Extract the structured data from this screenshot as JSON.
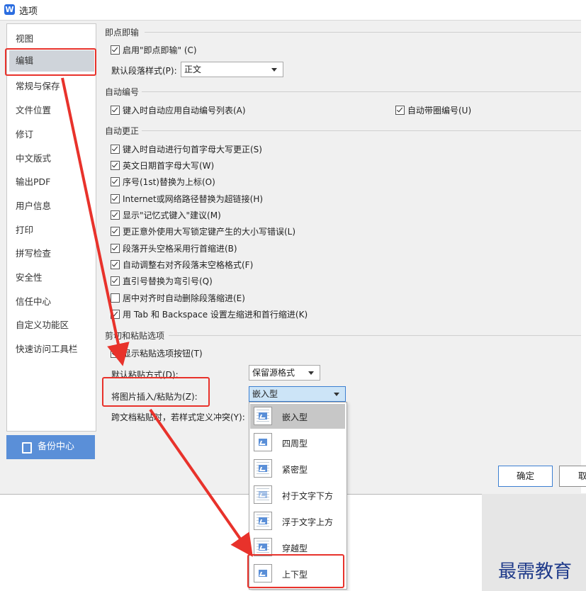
{
  "window": {
    "title": "选项",
    "icon": "app-w-icon"
  },
  "sidebar": {
    "items": [
      {
        "label": "视图"
      },
      {
        "label": "编辑",
        "selected": true
      },
      {
        "label": "常规与保存"
      },
      {
        "label": "文件位置"
      },
      {
        "label": "修订"
      },
      {
        "label": "中文版式"
      },
      {
        "label": "输出PDF"
      },
      {
        "label": "用户信息"
      },
      {
        "label": "打印"
      },
      {
        "label": "拼写检查"
      },
      {
        "label": "安全性"
      },
      {
        "label": "信任中心"
      },
      {
        "label": "自定义功能区"
      },
      {
        "label": "快速访问工具栏"
      }
    ],
    "backup_button": "备份中心"
  },
  "sections": {
    "click_and_type": {
      "title": "即点即输",
      "enable_label": "启用\"即点即输\" (C)",
      "enable_checked": true,
      "default_style_label": "默认段落样式(P):",
      "default_style_value": "正文"
    },
    "auto_numbering": {
      "title": "自动编号",
      "list_label": "键入时自动应用自动编号列表(A)",
      "list_checked": true,
      "circled_label": "自动带圈编号(U)",
      "circled_checked": true
    },
    "autocorrect": {
      "title": "自动更正",
      "items": [
        {
          "label": "键入时自动进行句首字母大写更正(S)",
          "checked": true
        },
        {
          "label": "英文日期首字母大写(W)",
          "checked": true
        },
        {
          "label": "序号(1st)替换为上标(O)",
          "checked": true
        },
        {
          "label": "Internet或网络路径替换为超链接(H)",
          "checked": true
        },
        {
          "label": "显示\"记忆式键入\"建议(M)",
          "checked": true
        },
        {
          "label": "更正意外使用大写锁定键产生的大小写错误(L)",
          "checked": true
        },
        {
          "label": "段落开头空格采用行首缩进(B)",
          "checked": true
        },
        {
          "label": "自动调整右对齐段落末空格格式(F)",
          "checked": true
        },
        {
          "label": "直引号替换为弯引号(Q)",
          "checked": true
        },
        {
          "label": "居中对齐时自动删除段落缩进(E)",
          "checked": false
        },
        {
          "label": "用 Tab 和 Backspace 设置左缩进和首行缩进(K)",
          "checked": true
        }
      ]
    },
    "paste": {
      "title": "剪切和粘贴选项",
      "show_button_label": "显示粘贴选项按钮(T)",
      "show_button_checked": true,
      "default_paste_label": "默认粘贴方式(D):",
      "default_paste_value": "保留源格式",
      "insert_picture_label": "将图片插入/粘贴为(Z):",
      "insert_picture_value": "嵌入型",
      "cross_doc_label": "跨文档粘贴时，若样式定义冲突(Y):"
    }
  },
  "dropdown": {
    "options": [
      {
        "label": "嵌入型",
        "highlighted": true
      },
      {
        "label": "四周型"
      },
      {
        "label": "紧密型"
      },
      {
        "label": "衬于文字下方"
      },
      {
        "label": "浮于文字上方"
      },
      {
        "label": "穿越型"
      },
      {
        "label": "上下型"
      }
    ]
  },
  "buttons": {
    "ok": "确定",
    "cancel": "取"
  },
  "watermark": "最需教育",
  "colors": {
    "annotation_red": "#e8322b",
    "accent_blue": "#5a8fd8",
    "watermark_blue": "#1f3a8a"
  }
}
